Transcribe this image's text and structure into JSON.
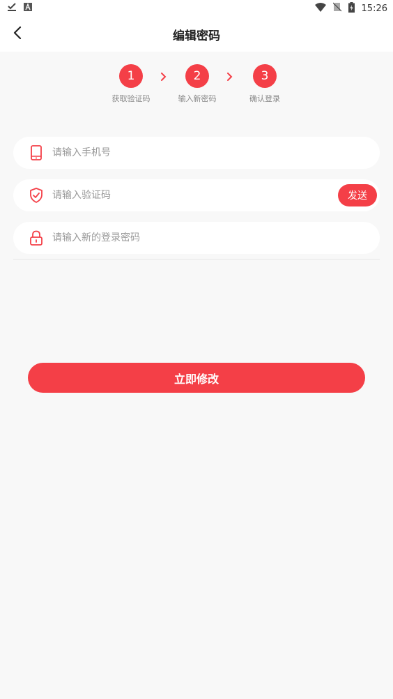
{
  "status_bar": {
    "time": "15:26",
    "left_icons": [
      "download-done-icon",
      "text-a-icon"
    ],
    "right_icons": [
      "wifi-icon",
      "no-sim-icon",
      "battery-charging-icon"
    ]
  },
  "header": {
    "title": "编辑密码",
    "back_icon": "chevron-left-icon"
  },
  "steps": [
    {
      "number": "1",
      "label": "获取验证码"
    },
    {
      "number": "2",
      "label": "输入新密码"
    },
    {
      "number": "3",
      "label": "确认登录"
    }
  ],
  "form": {
    "phone": {
      "placeholder": "请输入手机号",
      "value": "",
      "icon": "phone-icon"
    },
    "code": {
      "placeholder": "请输入验证码",
      "value": "",
      "icon": "shield-check-icon",
      "send_label": "发送"
    },
    "password": {
      "placeholder": "请输入新的登录密码",
      "value": "",
      "icon": "lock-icon"
    }
  },
  "submit_label": "立即修改",
  "colors": {
    "accent": "#f43f47",
    "background": "#f8f8f8",
    "field_background": "#ffffff",
    "placeholder": "#999999"
  }
}
